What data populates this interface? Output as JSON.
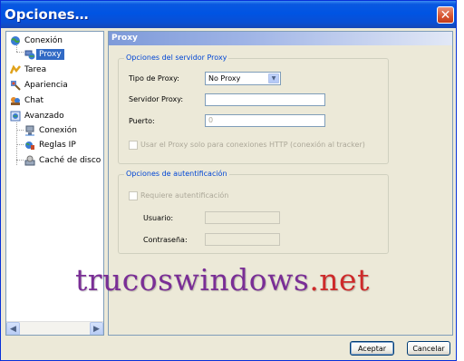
{
  "window": {
    "title": "Opciones…",
    "close_glyph": "✕"
  },
  "sidebar": {
    "items": [
      {
        "label": "Conexión",
        "icon": "network-globe-icon"
      },
      {
        "label": "Proxy",
        "icon": "proxy-icon",
        "selected": true
      },
      {
        "label": "Tarea",
        "icon": "task-icon"
      },
      {
        "label": "Apariencia",
        "icon": "appearance-icon"
      },
      {
        "label": "Chat",
        "icon": "chat-icon"
      },
      {
        "label": "Avanzado",
        "icon": "advanced-icon"
      },
      {
        "label": "Conexión",
        "icon": "connection-icon"
      },
      {
        "label": "Reglas IP",
        "icon": "ip-rules-icon"
      },
      {
        "label": "Caché de disco",
        "icon": "disk-cache-icon"
      }
    ],
    "expand_glyph": "−"
  },
  "panel": {
    "header": "Proxy"
  },
  "proxy_server": {
    "legend": "Opciones del servidor Proxy",
    "type_label": "Tipo de Proxy:",
    "type_value": "No Proxy",
    "server_label": "Servidor Proxy:",
    "server_value": "",
    "port_label": "Puerto:",
    "port_value": "0",
    "only_http_label": "Usar el Proxy solo para conexiones HTTP (conexión al tracker)"
  },
  "auth": {
    "legend": "Opciones de autentificación",
    "requires_label": "Requiere autentificación",
    "user_label": "Usuario:",
    "user_value": "",
    "password_label": "Contraseña:",
    "password_value": ""
  },
  "watermark": {
    "main": "trucoswindows",
    "tld": ".net"
  },
  "buttons": {
    "accept": "Aceptar",
    "cancel": "Cancelar"
  },
  "colors": {
    "titlebar": "#0054E3",
    "selection": "#316AC5",
    "legend_text": "#0046D5",
    "watermark_main": "#7A2E96",
    "watermark_tld": "#CE2A2A"
  }
}
